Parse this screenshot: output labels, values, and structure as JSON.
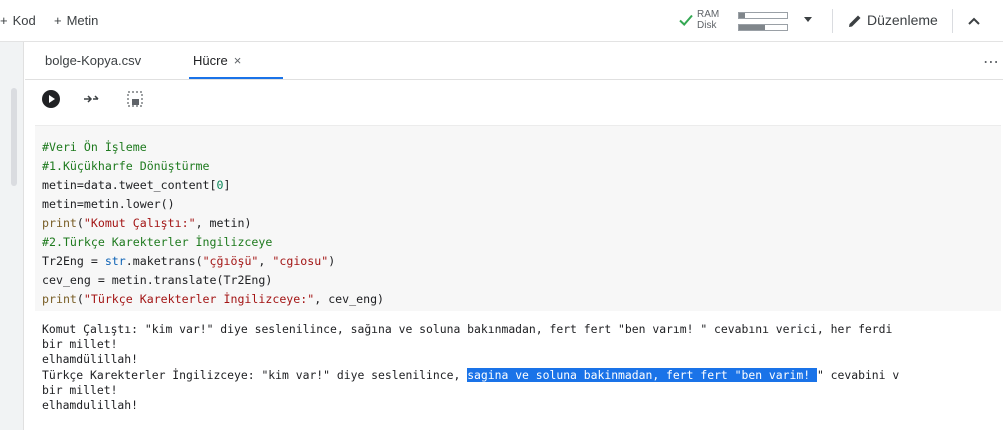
{
  "toolbar": {
    "add_code_label": "Kod",
    "add_text_label": "Metin",
    "resources": {
      "ram_label": "RAM",
      "disk_label": "Disk",
      "ram_fraction": 0.12,
      "disk_fraction": 0.55,
      "status_color": "#34a853"
    },
    "edit_label": "Düzenleme"
  },
  "tabs": [
    {
      "label": "bolge-Kopya.csv",
      "active": false
    },
    {
      "label": "Hücre",
      "active": true,
      "close": "×"
    }
  ],
  "more_menu": "⋯",
  "code_lines": {
    "l1": "#Veri Ön İşleme",
    "l2": "#1.Küçükharfe Dönüştürme",
    "l3_a": "metin=data.tweet_content[",
    "l3_num": "0",
    "l3_b": "]",
    "l4": "metin=metin.lower()",
    "l5_fn": "print",
    "l5_a": "(",
    "l5_str": "\"Komut Çalıştı:\"",
    "l5_b": ", metin)",
    "l6": "#2.Türkçe Karekterler İngilizceye",
    "l7_a": "Tr2Eng = ",
    "l7_bi": "str",
    "l7_b": ".maketrans(",
    "l7_s1": "\"çğıöşü\"",
    "l7_c": ", ",
    "l7_s2": "\"cgiosu\"",
    "l7_d": ")",
    "l8": "cev_eng = metin.translate(Tr2Eng)",
    "l9_fn": "print",
    "l9_a": "(",
    "l9_str": "\"Türkçe Karekterler İngilizceye:\"",
    "l9_b": ", cev_eng)"
  },
  "output": {
    "o1": "Komut Çalıştı: \"kim var!\" diye seslenilince, sağına ve soluna bakınmadan, fert fert \"ben varım! \" cevabını verici, her ferdi",
    "o2": "bir millet!",
    "o3": "elhamdülillah!",
    "o4_a": "Türkçe Karekterler İngilizceye: \"kim var!\" diye seslenilince, ",
    "o4_sel": "sagina ve soluna bakinmadan, fert fert \"ben varim! ",
    "o4_b": "\" cevabini v",
    "o5": "bir millet!",
    "o6": "elhamdulillah!"
  }
}
